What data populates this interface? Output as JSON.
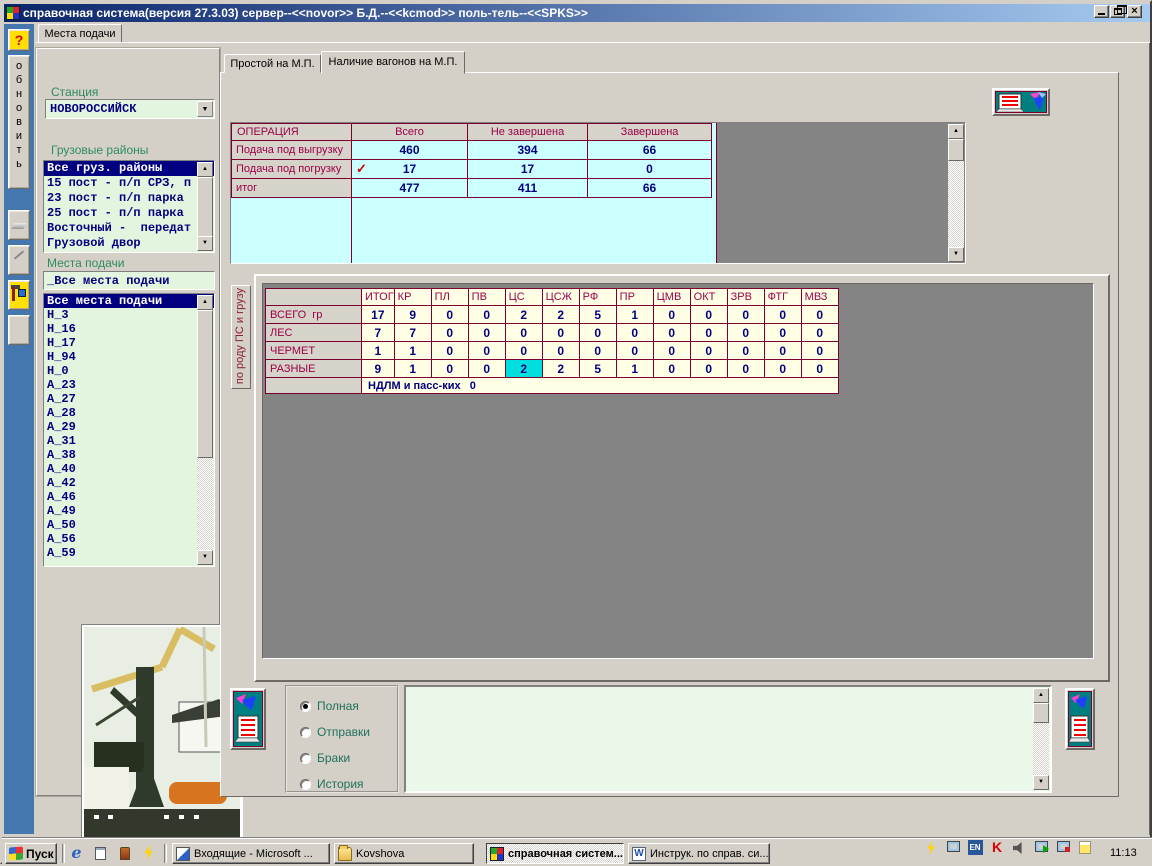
{
  "window": {
    "title": "справочная система(версия 27.3.03) сервер--<<novor>> Б.Д.--<<kcmod>> поль-тель--<<SPKS>>",
    "tab_label": "Места подачи"
  },
  "left_rail": {
    "help_label": "?",
    "refresh_label": "обновить"
  },
  "sidebar": {
    "station_label": "Станция",
    "station_value": "НОВОРОССИЙСК",
    "cargo_label": "Грузовые районы",
    "cargo_areas": [
      "Все груз. районы",
      "15 пост - п/п СРЗ, п",
      "23 пост - п/п парка",
      "25 пост - п/п парка",
      "Восточный -  передат",
      "Грузовой двор"
    ],
    "places_label": "Места подачи",
    "places_filter": "_Все места подачи",
    "places": [
      "Все места подачи",
      "Н_3",
      "Н_16",
      "Н_17",
      "Н_94",
      "Н_0",
      "А_23",
      "А_27",
      "А_28",
      "А_29",
      "А_31",
      "А_38",
      "А_40",
      "А_42",
      "А_46",
      "А_49",
      "А_50",
      "А_56",
      "А_59"
    ]
  },
  "tabs": [
    {
      "label": "Простой на М.П.",
      "active": false
    },
    {
      "label": "Наличие вагонов на М.П.",
      "active": true
    }
  ],
  "operations_table": {
    "headers": [
      "ОПЕРАЦИЯ",
      "Всего",
      "Не завершена",
      "Завершена"
    ],
    "rows": [
      {
        "label": "Подача под выгрузку",
        "values": [
          "460",
          "394",
          "66"
        ],
        "checked": false
      },
      {
        "label": "Подача под погрузку",
        "values": [
          "17",
          "17",
          "0"
        ],
        "checked": true
      },
      {
        "label": "итог",
        "values": [
          "477",
          "411",
          "66"
        ],
        "checked": false
      }
    ],
    "check_glyph": "✓"
  },
  "wagons_table": {
    "side_label": "по роду ПС и грузу",
    "headers": [
      "ИТОГ",
      "КР",
      "ПЛ",
      "ПВ",
      "ЦС",
      "ЦСЖ",
      "РФ",
      "ПР",
      "ЦМВ",
      "ОКТ",
      "ЗРВ",
      "ФТГ",
      "МВЗ"
    ],
    "rows": [
      {
        "label": "ВСЕГО  гр",
        "values": [
          "17",
          "9",
          "0",
          "0",
          "2",
          "2",
          "5",
          "1",
          "0",
          "0",
          "0",
          "0",
          "0"
        ],
        "highlight": -1
      },
      {
        "label": "ЛЕС",
        "values": [
          "7",
          "7",
          "0",
          "0",
          "0",
          "0",
          "0",
          "0",
          "0",
          "0",
          "0",
          "0",
          "0"
        ],
        "highlight": -1
      },
      {
        "label": "ЧЕРМЕТ",
        "values": [
          "1",
          "1",
          "0",
          "0",
          "0",
          "0",
          "0",
          "0",
          "0",
          "0",
          "0",
          "0",
          "0"
        ],
        "highlight": -1
      },
      {
        "label": "РАЗНЫЕ",
        "values": [
          "9",
          "1",
          "0",
          "0",
          "2",
          "2",
          "5",
          "1",
          "0",
          "0",
          "0",
          "0",
          "0"
        ],
        "highlight": 4
      }
    ],
    "footer": "НДЛМ и пасс-ких   0"
  },
  "report_options": [
    {
      "label": "Полная",
      "selected": true
    },
    {
      "label": "Отправки",
      "selected": false
    },
    {
      "label": "Браки",
      "selected": false
    },
    {
      "label": "История",
      "selected": false
    }
  ],
  "taskbar": {
    "start_label": "Пуск",
    "tasks": [
      {
        "label": "Входящие - Microsoft ...",
        "icon": "outlook",
        "active": false
      },
      {
        "label": "Kovshova",
        "icon": "folder",
        "active": false
      },
      {
        "label": "справочная систем...",
        "icon": "app",
        "active": true
      },
      {
        "label": "Инструк. по справ. си...",
        "icon": "word",
        "active": false
      }
    ],
    "quick_launch": [
      "internet-explorer",
      "desktop",
      "paint",
      "launcher"
    ],
    "tray_icons": [
      "lightning",
      "computer",
      "language",
      "antivirus",
      "speaker",
      "net-play",
      "remote-display",
      "notes"
    ],
    "tray_language": "EN",
    "clock": "11:13"
  },
  "colors": {
    "maroon_border": "#7B0030",
    "maroon_text": "#9C0048",
    "navy_text": "#000080",
    "cyan_cell": "#CCFFFF",
    "highlight_cyan": "#00DEDE",
    "cream_cell": "#FFFFE6",
    "pale_green": "#E4F5DF",
    "label_green": "#2E8B62",
    "rail_blue": "#4377AE",
    "teal_icon": "#007F80"
  }
}
